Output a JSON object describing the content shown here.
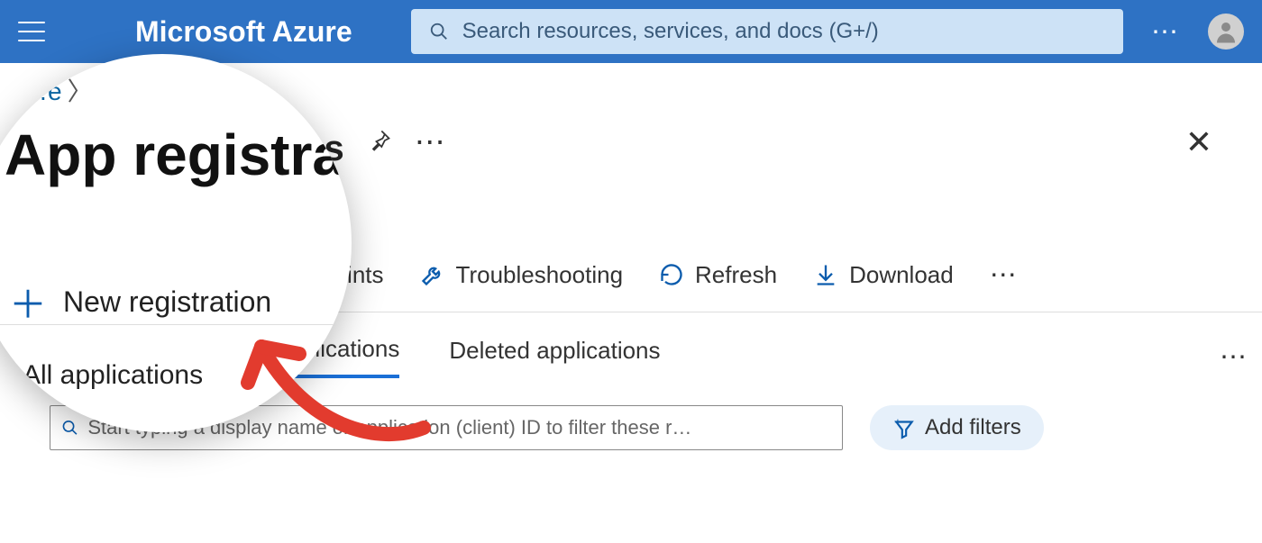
{
  "header": {
    "logo": "Microsoft Azure",
    "search_placeholder": "Search resources, services, and docs (G+/)"
  },
  "breadcrumb": {
    "home_fragment": "…e"
  },
  "page": {
    "title": "App registra",
    "title_suffix": "ns"
  },
  "toolbar": {
    "new_registration": "New registration",
    "endpoints": "Endpoints",
    "troubleshooting": "Troubleshooting",
    "refresh": "Refresh",
    "download": "Download"
  },
  "tabs": {
    "all": "All applications",
    "owned": "vned applications",
    "deleted": "Deleted applications"
  },
  "filter": {
    "placeholder": "Start typing a display name or application (client) ID to filter these r…",
    "add_filters": "Add filters"
  },
  "magnifier": {
    "breadcrumb": "…e",
    "title": "App registra",
    "new_registration": "New registration",
    "tab_all": "All applications"
  }
}
